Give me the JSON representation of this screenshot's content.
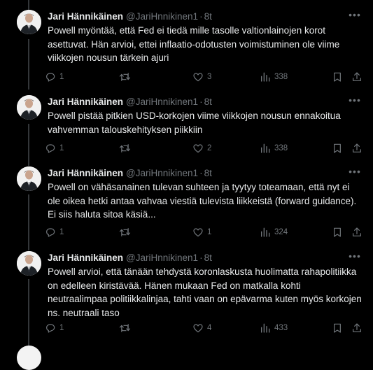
{
  "tweets": [
    {
      "name": "Jari Hännikäinen",
      "handle": "@JariHnnikinen1",
      "time": "8t",
      "text": "Powell myöntää, että Fed ei tiedä mille tasolle valtionlainojen korot asettuvat. Hän arvioi, ettei inflaatio-odotusten voimistuminen ole viime viikkojen nousun tärkein ajuri",
      "replies": "1",
      "retweets": "",
      "likes": "3",
      "views": "338"
    },
    {
      "name": "Jari Hännikäinen",
      "handle": "@JariHnnikinen1",
      "time": "8t",
      "text": "Powell pistää pitkien USD-korkojen viime viikkojen nousun ennakoitua vahvemman talouskehityksen piikkiin",
      "replies": "1",
      "retweets": "",
      "likes": "2",
      "views": "338"
    },
    {
      "name": "Jari Hännikäinen",
      "handle": "@JariHnnikinen1",
      "time": "8t",
      "text": "Powell on vähäsanainen tulevan suhteen ja tyytyy toteamaan, että nyt ei ole oikea hetki antaa vahvaa viestiä tulevista liikkeistä (forward guidance). Ei siis haluta sitoa käsiä...",
      "replies": "1",
      "retweets": "",
      "likes": "1",
      "views": "324"
    },
    {
      "name": "Jari Hännikäinen",
      "handle": "@JariHnnikinen1",
      "time": "8t",
      "text": "Powell arvioi, että tänään tehdystä koronlaskusta huolimatta rahapolitiikka on edelleen kiristävää. Hänen mukaan Fed on matkalla kohti neutraalimpaa politiikkalinjaa, tahti vaan on epävarma kuten myös korkojen ns. neutraali taso",
      "replies": "1",
      "retweets": "",
      "likes": "4",
      "views": "433"
    }
  ],
  "icons": {
    "reply": "reply-icon",
    "retweet": "retweet-icon",
    "like": "heart-icon",
    "views": "views-icon",
    "bookmark": "bookmark-icon",
    "share": "share-icon",
    "more": "more-icon"
  },
  "colors": {
    "background": "#000000",
    "text": "#e7e9ea",
    "secondary": "#71767b",
    "thread_line": "#333639"
  }
}
